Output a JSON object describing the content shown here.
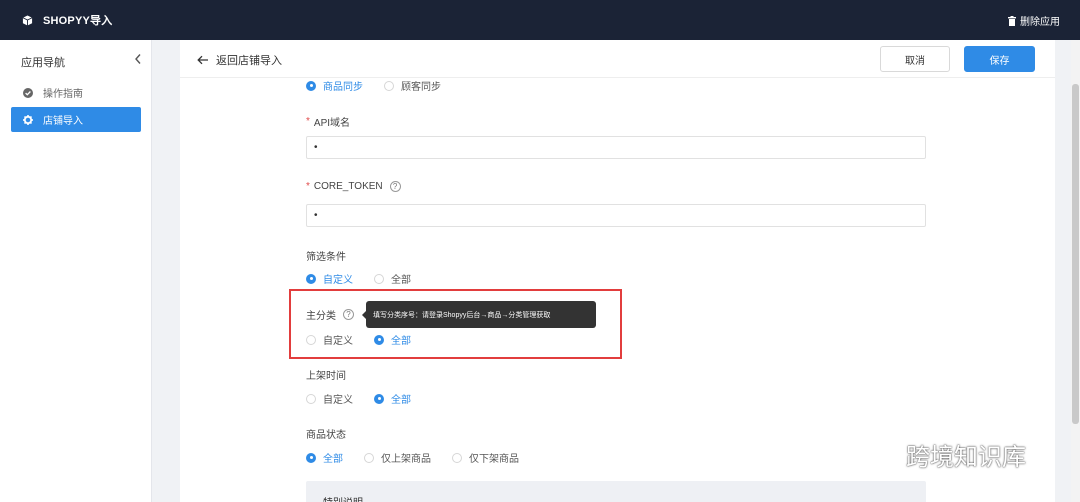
{
  "topbar": {
    "app_title": "SHOPYY导入",
    "delete_label": "删除应用"
  },
  "sidebar": {
    "heading": "应用导航",
    "items": [
      {
        "label": "操作指南",
        "icon": "check-circle-icon",
        "active": false
      },
      {
        "label": "店铺导入",
        "icon": "gear-icon",
        "active": true
      }
    ]
  },
  "header": {
    "back_label": "返回店铺导入",
    "cancel_label": "取消",
    "save_label": "保存"
  },
  "form": {
    "sync_type": {
      "options": [
        "商品同步",
        "顾客同步"
      ],
      "selected": "商品同步"
    },
    "api_domain": {
      "label": "API域名",
      "value": "•"
    },
    "core_token": {
      "label": "CORE_TOKEN",
      "value": "•"
    },
    "filter": {
      "label": "筛选条件",
      "options": [
        "自定义",
        "全部"
      ],
      "selected": "自定义"
    },
    "main_category": {
      "label": "主分类",
      "tooltip": "填写分类序号：请登录Shopyy后台→商品→分类管理获取",
      "options": [
        "自定义",
        "全部"
      ],
      "selected": "全部"
    },
    "listing_time": {
      "label": "上架时间",
      "options": [
        "自定义",
        "全部"
      ],
      "selected": "全部"
    },
    "product_status": {
      "label": "商品状态",
      "options": [
        "全部",
        "仅上架商品",
        "仅下架商品"
      ],
      "selected": "全部"
    },
    "note_title": "特别说明"
  },
  "watermark": {
    "text": "跨境知识库"
  },
  "colors": {
    "topbar_bg": "#1b2336",
    "accent": "#2f8be6",
    "highlight_border": "#e23d3d"
  }
}
